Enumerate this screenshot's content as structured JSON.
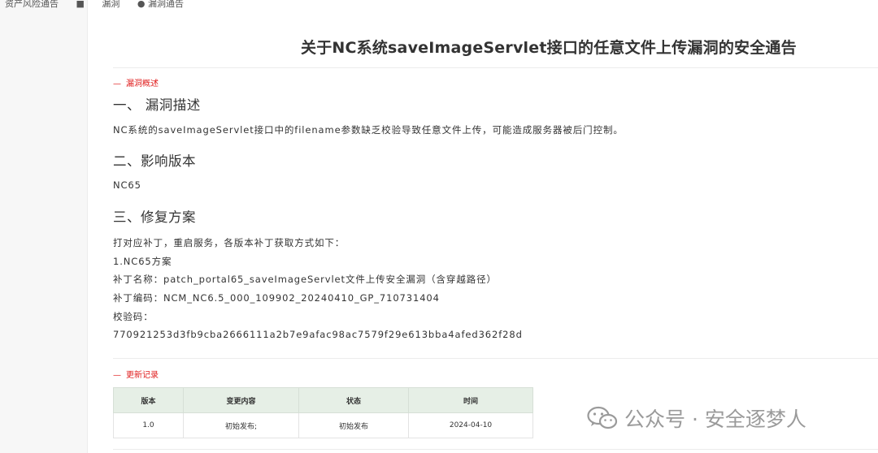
{
  "top_strip": {
    "items": [
      "资产风险通告",
      "■",
      "漏洞",
      "● 漏洞通告"
    ]
  },
  "document": {
    "title": "关于NC系统saveImageServlet接口的任意文件上传漏洞的安全通告",
    "overview_tag": "漏洞概述",
    "sections": [
      {
        "heading": "一、  漏洞描述",
        "body": [
          "NC系统的saveImageServlet接口中的filename参数缺乏校验导致任意文件上传，可能造成服务器被后门控制。"
        ]
      },
      {
        "heading": "二、影响版本",
        "body": [
          "NC65"
        ]
      },
      {
        "heading": "三、修复方案",
        "body": [
          "打对应补丁，重启服务，各版本补丁获取方式如下：",
          "1.NC65方案",
          "补丁名称：patch_portal65_saveImageServlet文件上传安全漏洞（含穿越路径）",
          "补丁编码：NCM_NC6.5_000_109902_20240410_GP_710731404",
          "校验码：",
          "770921253d3fb9cba2666111a2b7e9afac98ac7579f29e613bba4afed362f28d"
        ]
      }
    ],
    "records_tag": "更新记录",
    "records_table": {
      "headers": [
        "版本",
        "变更内容",
        "状态",
        "时间"
      ],
      "rows": [
        [
          "1.0",
          "初始发布;",
          "初始发布",
          "2024-04-10"
        ]
      ]
    }
  },
  "watermark": {
    "icon": "wechat-icon",
    "text": "公众号 · 安全逐梦人"
  },
  "colors": {
    "accent_red": "#e02020",
    "table_header": "#e6efe6"
  }
}
